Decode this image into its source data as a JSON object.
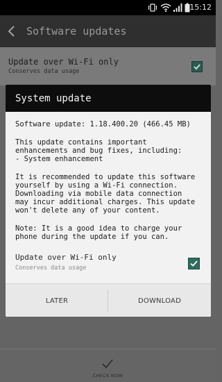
{
  "status_bar": {
    "time": "15:12",
    "icons": [
      "vibrate-icon",
      "wifi-icon",
      "signal-icon",
      "battery-icon"
    ]
  },
  "app_bar": {
    "title": "Software updates",
    "back_icon": "back-arrow-icon"
  },
  "background_setting": {
    "label": "Update over Wi-Fi only",
    "sublabel": "Conserves data usage",
    "checked": true
  },
  "dialog": {
    "title": "System update",
    "version_line": "Software update: 1.18.400.20 (466.45 MB)",
    "description_lines": [
      "This update contains important",
      "enhancements and bug fixes, including:",
      "- System enhancement"
    ],
    "recommendation_lines": [
      "It is recommended to update this software",
      "yourself by using a Wi-Fi connection.",
      "Downloading via mobile data connection",
      "may incur additional charges. This update",
      "won't delete any of your content."
    ],
    "note_lines": [
      "Note: It is a good idea to charge your",
      "phone during the update if you can."
    ],
    "wifi_only": {
      "label": "Update over Wi-Fi only",
      "sublabel": "Conserves data usage",
      "checked": true
    },
    "buttons": {
      "later": "LATER",
      "download": "DOWNLOAD"
    }
  },
  "bottom_bar": {
    "check_now_label": "CHECK NOW",
    "icon": "checkmark-icon"
  },
  "colors": {
    "accent": "#2f6b5f",
    "dialog_header": "#0d0d0d",
    "app_bar": "#2f2f2f"
  }
}
